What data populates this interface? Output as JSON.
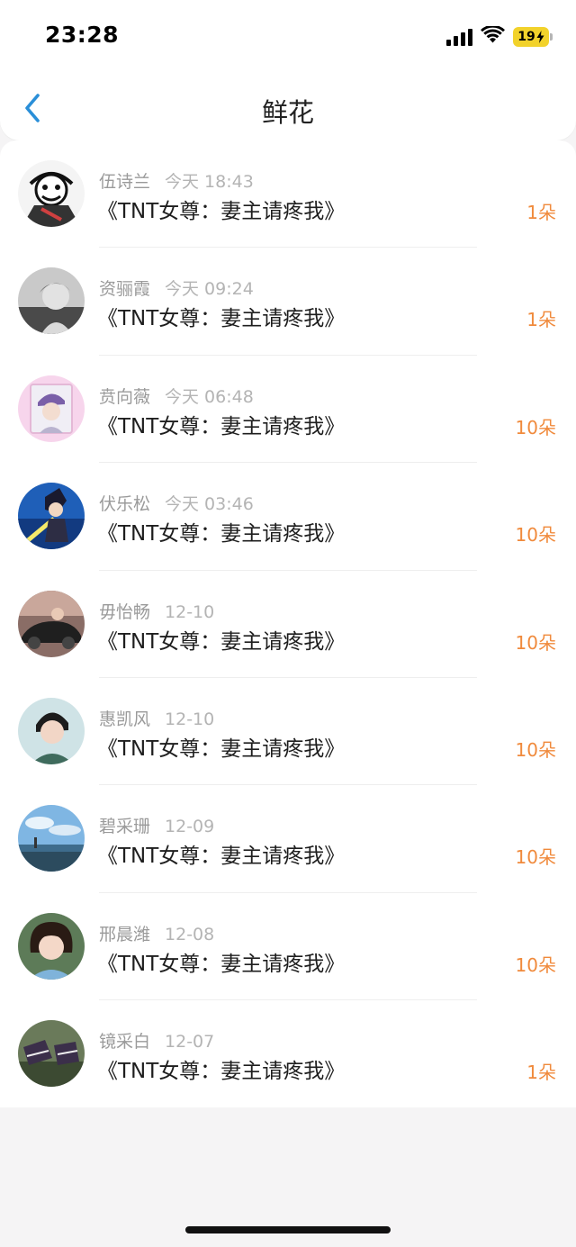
{
  "status_bar": {
    "time": "23:28",
    "battery": "19",
    "icons": [
      "signal-icon",
      "wifi-icon",
      "battery-icon"
    ]
  },
  "nav": {
    "title": "鲜花",
    "back_icon": "chevron-left-icon"
  },
  "colors": {
    "accent": "#2a8fd8",
    "count": "#f08a3c",
    "secondary_text": "#9e9e9e"
  },
  "items": [
    {
      "name": "伍诗兰",
      "time": "今天 18:43",
      "book": "《TNT女尊：妻主请疼我》",
      "count": "1朵"
    },
    {
      "name": "资骊霞",
      "time": "今天 09:24",
      "book": "《TNT女尊：妻主请疼我》",
      "count": "1朵"
    },
    {
      "name": "贲向薇",
      "time": "今天 06:48",
      "book": "《TNT女尊：妻主请疼我》",
      "count": "10朵"
    },
    {
      "name": "伏乐松",
      "time": "今天 03:46",
      "book": "《TNT女尊：妻主请疼我》",
      "count": "10朵"
    },
    {
      "name": "毋怡畅",
      "time": "12-10",
      "book": "《TNT女尊：妻主请疼我》",
      "count": "10朵"
    },
    {
      "name": "惠凯风",
      "time": "12-10",
      "book": "《TNT女尊：妻主请疼我》",
      "count": "10朵"
    },
    {
      "name": "碧采珊",
      "time": "12-09",
      "book": "《TNT女尊：妻主请疼我》",
      "count": "10朵"
    },
    {
      "name": "邢晨潍",
      "time": "12-08",
      "book": "《TNT女尊：妻主请疼我》",
      "count": "10朵"
    },
    {
      "name": "镜采白",
      "time": "12-07",
      "book": "《TNT女尊：妻主请疼我》",
      "count": "1朵"
    }
  ]
}
